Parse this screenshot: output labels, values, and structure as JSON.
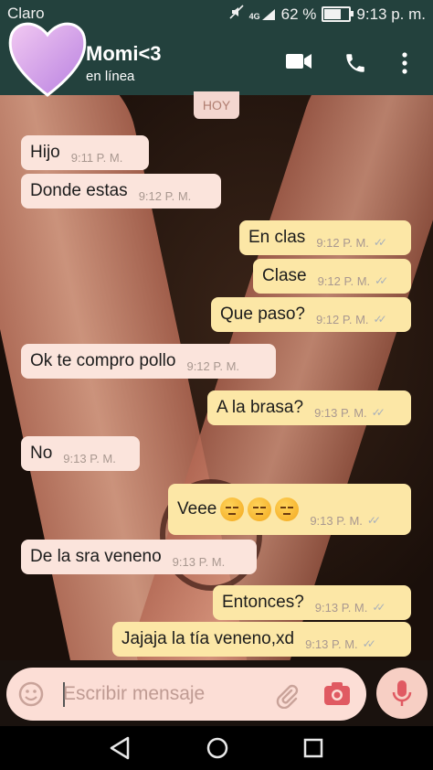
{
  "status_bar": {
    "carrier": "Claro",
    "network": "4G",
    "battery": "62 %",
    "battery_level": 0.62,
    "time": "9:13 p. m."
  },
  "header": {
    "contact_name": "Momi<3",
    "presence": "en línea",
    "avatar_icon": "heart-icon",
    "icons": [
      "video-call-icon",
      "phone-icon",
      "more-vert-icon"
    ]
  },
  "chat": {
    "date_chip": "HOY",
    "messages": [
      {
        "dir": "in",
        "text": "Hijo",
        "time": "9:11 P. M."
      },
      {
        "dir": "in",
        "text": "Donde estas",
        "time": "9:12 P. M."
      },
      {
        "dir": "out",
        "text": "En clas",
        "time": "9:12 P. M."
      },
      {
        "dir": "out",
        "text": "Clase",
        "time": "9:12 P. M."
      },
      {
        "dir": "out",
        "text": "Que paso?",
        "time": "9:12 P. M."
      },
      {
        "dir": "in",
        "text": "Ok te compro pollo",
        "time": "9:12 P. M."
      },
      {
        "dir": "out",
        "text": "A la brasa?",
        "time": "9:13 P. M."
      },
      {
        "dir": "in",
        "text": "No",
        "time": "9:13 P. M."
      },
      {
        "dir": "out",
        "text": "Veee",
        "time": "9:13 P. M.",
        "emojis": [
          "unamused-face-emoji",
          "unamused-face-emoji",
          "unamused-face-emoji"
        ]
      },
      {
        "dir": "in",
        "text": "De la sra veneno",
        "time": "9:13 P. M."
      },
      {
        "dir": "out",
        "text": "Entonces?",
        "time": "9:13 P. M."
      },
      {
        "dir": "out",
        "text": "Jajaja la tía veneno,xd",
        "time": "9:13 P. M."
      }
    ],
    "read_ticks": "✓✓"
  },
  "input": {
    "placeholder": "Escribir mensaje",
    "icons": [
      "emoji-icon",
      "attach-icon",
      "camera-icon",
      "mic-icon"
    ]
  },
  "nav": {
    "icons": [
      "back-icon",
      "home-icon",
      "recents-icon"
    ]
  },
  "colors": {
    "header_bg": "#23413d",
    "incoming_bubble": "#fbe4dc",
    "outgoing_bubble": "#fce7a6",
    "tick_color": "#a8b0ba"
  }
}
